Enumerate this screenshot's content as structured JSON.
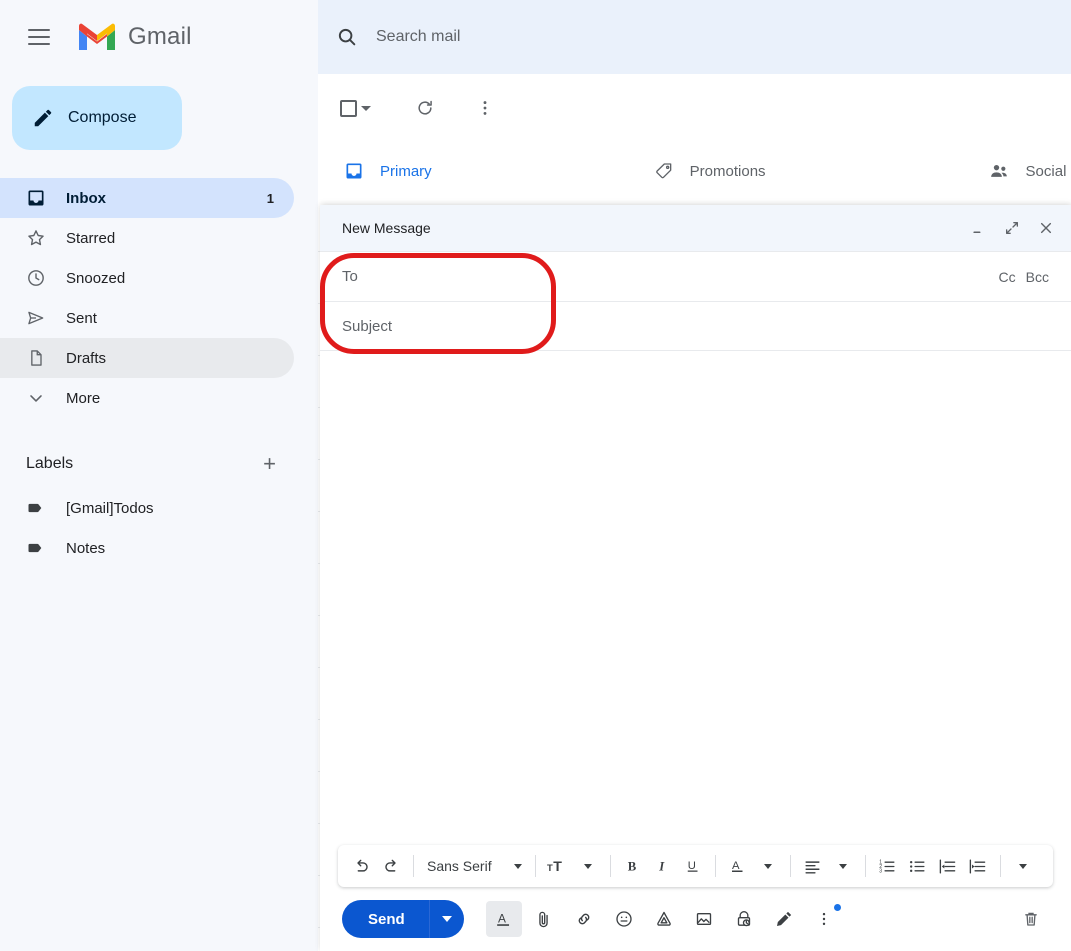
{
  "app": {
    "brand": "Gmail",
    "menu_icon": "hamburger-icon"
  },
  "compose_button": {
    "label": "Compose",
    "icon": "pencil-icon"
  },
  "sidebar": {
    "items": [
      {
        "label": "Inbox",
        "icon": "inbox-icon",
        "count": "1",
        "state": "active"
      },
      {
        "label": "Starred",
        "icon": "star-icon",
        "count": "",
        "state": ""
      },
      {
        "label": "Snoozed",
        "icon": "clock-icon",
        "count": "",
        "state": ""
      },
      {
        "label": "Sent",
        "icon": "send-icon",
        "count": "",
        "state": ""
      },
      {
        "label": "Drafts",
        "icon": "document-icon",
        "count": "",
        "state": "hover"
      },
      {
        "label": "More",
        "icon": "chevron-down-icon",
        "count": "",
        "state": ""
      }
    ],
    "labels_header": {
      "title": "Labels",
      "add_icon": "plus-icon"
    },
    "labels": [
      {
        "label": "[Gmail]Todos",
        "icon": "label-tag-icon"
      },
      {
        "label": "Notes",
        "icon": "label-tag-icon"
      }
    ]
  },
  "search": {
    "placeholder": "Search mail",
    "icon": "search-icon"
  },
  "list_toolbar": {
    "select_all": "select-all-checkbox",
    "select_caret": "chevron-down-icon",
    "refresh": "refresh-icon",
    "more": "more-vertical-icon"
  },
  "tabs": [
    {
      "label": "Primary",
      "icon": "inbox-icon",
      "active": true
    },
    {
      "label": "Promotions",
      "icon": "tag-icon",
      "active": false
    },
    {
      "label": "Social",
      "icon": "people-icon",
      "active": false
    }
  ],
  "compose_window": {
    "title": "New Message",
    "minimize_icon": "minimize-icon",
    "expand_icon": "expand-icon",
    "close_icon": "close-icon",
    "to_placeholder": "To",
    "cc_label": "Cc",
    "bcc_label": "Bcc",
    "subject_placeholder": "Subject",
    "body_text": ""
  },
  "format_toolbar": {
    "undo": "undo-icon",
    "redo": "redo-icon",
    "font_family": "Sans Serif",
    "font_family_caret": "chevron-down-icon",
    "font_size": "format-size-icon",
    "bold": "B",
    "italic": "I",
    "underline": "U",
    "text_color": "A",
    "align": "align-left-icon",
    "numbered_list": "numbered-list-icon",
    "bulleted_list": "bulleted-list-icon",
    "indent_less": "indent-less-icon",
    "indent_more": "indent-more-icon",
    "more_options": "chevron-down-icon"
  },
  "send_bar": {
    "send_label": "Send",
    "send_caret": "chevron-down-icon",
    "icons": [
      "format-text-icon",
      "attach-file-icon",
      "insert-link-icon",
      "insert-emoji-icon",
      "insert-drive-icon",
      "insert-photo-icon",
      "confidential-mode-icon",
      "insert-signature-icon",
      "more-options-icon"
    ],
    "discard_icon": "trash-icon"
  },
  "annotation": {
    "shape": "rounded-rectangle",
    "color": "#e01b1b",
    "target": "to-and-subject-fields"
  },
  "colors": {
    "accent_blue": "#1a73e8",
    "send_blue": "#0b57d0",
    "sidebar_bg": "#f6f8fc",
    "active_nav": "#d3e3fd",
    "compose_chip": "#c2e7ff",
    "annotation_red": "#e01b1b"
  }
}
